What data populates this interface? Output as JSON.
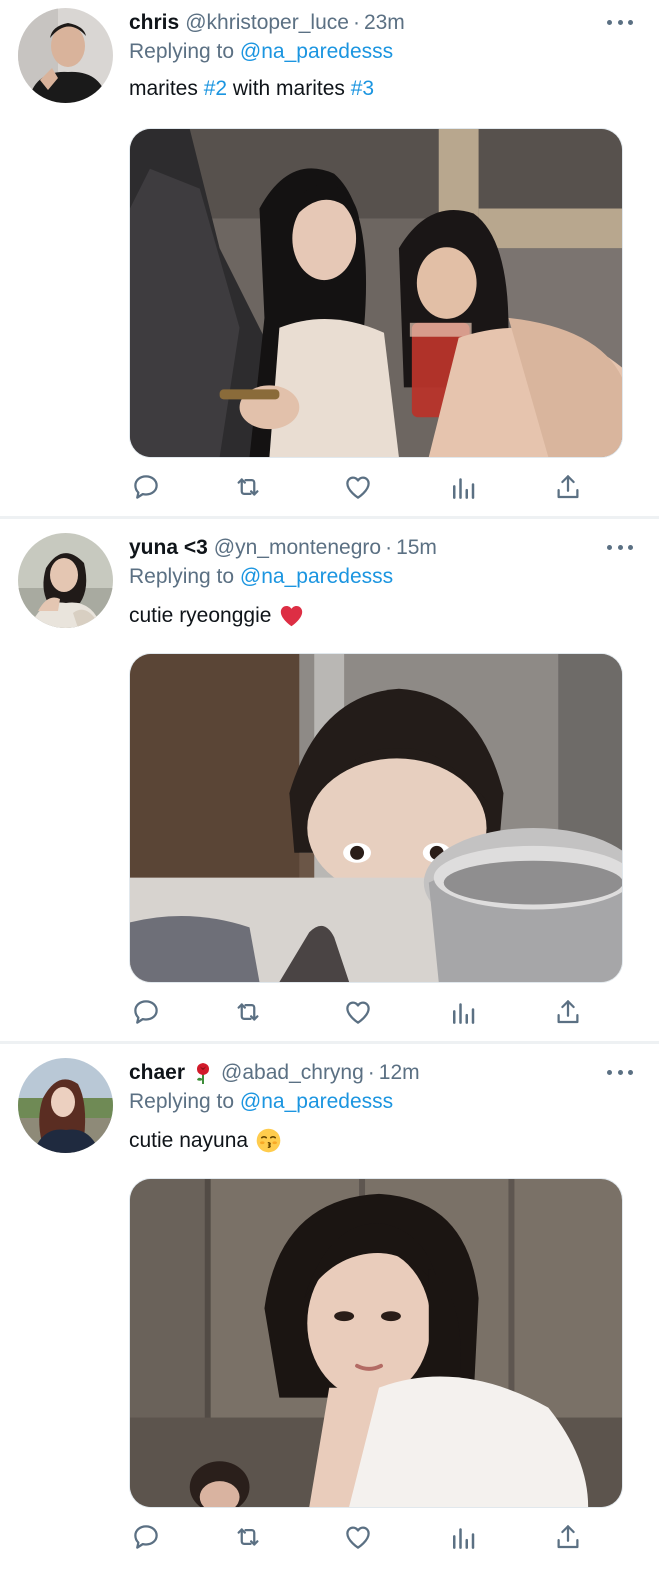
{
  "tweets": [
    {
      "name": "chris",
      "handle": "@khristoper_luce",
      "separator": "·",
      "time": "23m",
      "replying_prefix": "Replying to",
      "replying_to": "@na_paredesss",
      "text_parts": [
        "marites ",
        "#2",
        " with marites ",
        "#3"
      ],
      "media_icon": "photo-two-women-drink",
      "avatar_icon": "avatar-man"
    },
    {
      "name": "yuna <3",
      "handle": "@yn_montenegro",
      "separator": "·",
      "time": "15m",
      "replying_prefix": "Replying to",
      "replying_to": "@na_paredesss",
      "text": "cutie ryeonggie",
      "emoji": "red-heart-icon",
      "media_icon": "photo-girl-peeking-pot",
      "avatar_icon": "avatar-woman"
    },
    {
      "name": "chaer",
      "name_emoji": "rose-icon",
      "handle": "@abad_chryng",
      "separator": "·",
      "time": "12m",
      "replying_prefix": "Replying to",
      "replying_to": "@na_paredesss",
      "text": "cutie nayuna",
      "emoji": "kissing-face-icon",
      "media_icon": "photo-woman-white-shirt",
      "avatar_icon": "avatar-woman-outdoor"
    }
  ],
  "actions": [
    "reply-icon",
    "retweet-icon",
    "like-icon",
    "analytics-icon",
    "share-icon"
  ],
  "colors": {
    "link": "#1b95e0",
    "secondary_text": "#5b7083",
    "primary_text": "#0f1419",
    "divider": "#eef1f3"
  }
}
